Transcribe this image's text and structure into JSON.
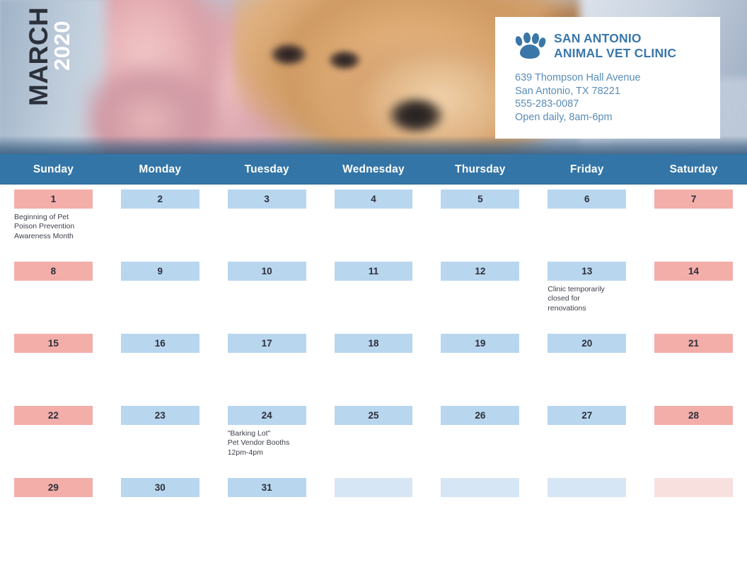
{
  "month_label": {
    "month": "MARCH",
    "year": "2020"
  },
  "clinic": {
    "icon": "paw-print-icon",
    "name_line1": "SAN ANTONIO",
    "name_line2": "ANIMAL VET CLINIC",
    "address_line1": "639 Thompson Hall Avenue",
    "address_line2": "San Antonio, TX 78221",
    "phone": "555-283-0087",
    "hours": "Open daily, 8am-6pm"
  },
  "weekdays": [
    "Sunday",
    "Monday",
    "Tuesday",
    "Wednesday",
    "Thursday",
    "Friday",
    "Saturday"
  ],
  "colors": {
    "header_bar": "#3375a6",
    "weekday_cell": "#b9d6ef",
    "weekend_cell": "#f3aeaa",
    "weekday_cell_empty": "#d7e6f5",
    "weekend_cell_empty": "#f8e0de",
    "brand_blue": "#3a77ab",
    "detail_blue": "#5a8cb8",
    "date_text": "#2b2f3a"
  },
  "days": [
    {
      "date": "1",
      "type": "weekend",
      "event": "Beginning of Pet\nPoison Prevention\nAwareness Month"
    },
    {
      "date": "2",
      "type": "weekday",
      "event": ""
    },
    {
      "date": "3",
      "type": "weekday",
      "event": ""
    },
    {
      "date": "4",
      "type": "weekday",
      "event": ""
    },
    {
      "date": "5",
      "type": "weekday",
      "event": ""
    },
    {
      "date": "6",
      "type": "weekday",
      "event": ""
    },
    {
      "date": "7",
      "type": "weekend",
      "event": ""
    },
    {
      "date": "8",
      "type": "weekend",
      "event": ""
    },
    {
      "date": "9",
      "type": "weekday",
      "event": ""
    },
    {
      "date": "10",
      "type": "weekday",
      "event": ""
    },
    {
      "date": "11",
      "type": "weekday",
      "event": ""
    },
    {
      "date": "12",
      "type": "weekday",
      "event": ""
    },
    {
      "date": "13",
      "type": "weekday",
      "event": "Clinic temporarily\nclosed for\nrenovations"
    },
    {
      "date": "14",
      "type": "weekend",
      "event": ""
    },
    {
      "date": "15",
      "type": "weekend",
      "event": ""
    },
    {
      "date": "16",
      "type": "weekday",
      "event": ""
    },
    {
      "date": "17",
      "type": "weekday",
      "event": ""
    },
    {
      "date": "18",
      "type": "weekday",
      "event": ""
    },
    {
      "date": "19",
      "type": "weekday",
      "event": ""
    },
    {
      "date": "20",
      "type": "weekday",
      "event": ""
    },
    {
      "date": "21",
      "type": "weekend",
      "event": ""
    },
    {
      "date": "22",
      "type": "weekend",
      "event": ""
    },
    {
      "date": "23",
      "type": "weekday",
      "event": ""
    },
    {
      "date": "24",
      "type": "weekday",
      "event": "\"Barking Lot\"\nPet Vendor Booths\n12pm-4pm"
    },
    {
      "date": "25",
      "type": "weekday",
      "event": ""
    },
    {
      "date": "26",
      "type": "weekday",
      "event": ""
    },
    {
      "date": "27",
      "type": "weekday",
      "event": ""
    },
    {
      "date": "28",
      "type": "weekend",
      "event": ""
    },
    {
      "date": "29",
      "type": "weekend",
      "event": ""
    },
    {
      "date": "30",
      "type": "weekday",
      "event": ""
    },
    {
      "date": "31",
      "type": "weekday",
      "event": ""
    },
    {
      "date": "",
      "type": "weekday-empty",
      "event": ""
    },
    {
      "date": "",
      "type": "weekday-empty",
      "event": ""
    },
    {
      "date": "",
      "type": "weekday-empty",
      "event": ""
    },
    {
      "date": "",
      "type": "weekend-empty",
      "event": ""
    }
  ]
}
